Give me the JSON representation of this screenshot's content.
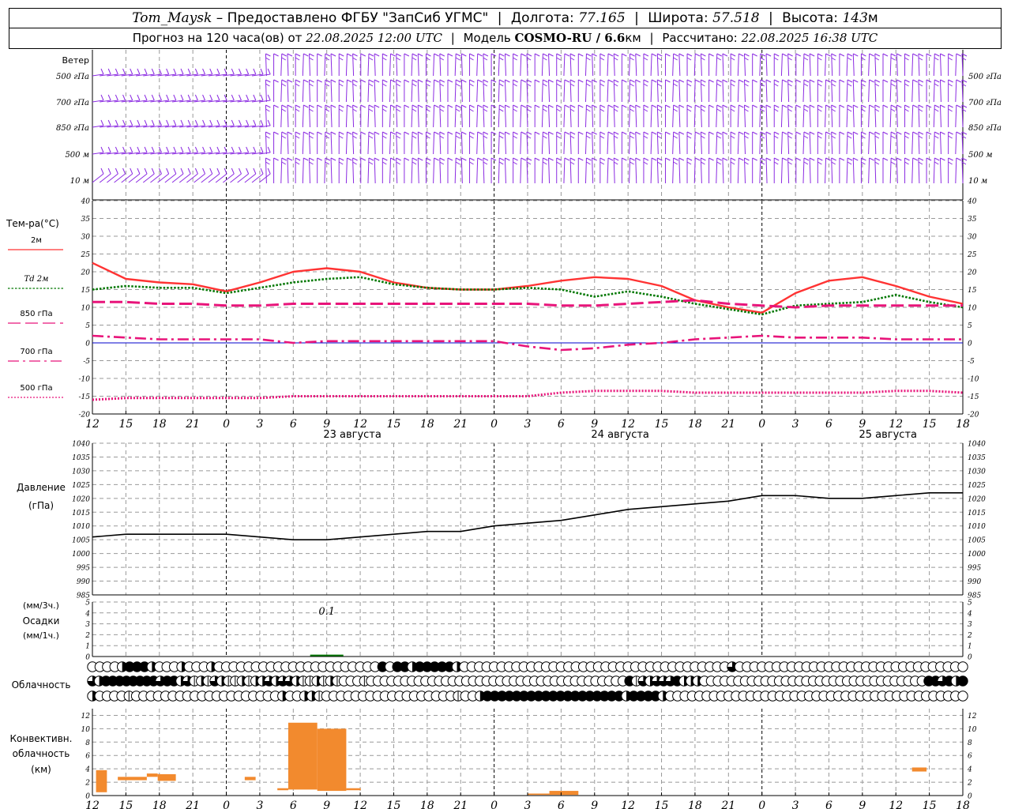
{
  "header": {
    "station": "Tom_Maysk",
    "provider": "– Предоставлено ФГБУ \"ЗапСиб УГМС\"",
    "lon_label": "Долгота:",
    "lon_value": "77.165",
    "lat_label": "Широта:",
    "lat_value": "57.518",
    "alt_label": "Высота:",
    "alt_value": "143",
    "alt_unit": "м",
    "forecast_prefix": "Прогноз на 120 часа(ов) от",
    "forecast_date": "22.08.2025 12:00 UTC",
    "model_label": "Модель",
    "model_name": "COSMO-RU / 6.6",
    "model_unit": "км",
    "calc_label": "Рассчитано:",
    "calc_date": "22.08.2025 16:38 UTC"
  },
  "labels": {
    "wind_title": "Ветер",
    "wind_levels": [
      "500 гПа",
      "700 гПа",
      "850 гПа",
      "500 м",
      "10 м"
    ],
    "temp_title": "Тем-ра(°C)",
    "temp_legend": [
      "2м",
      "Td 2м",
      "850 гПа",
      "700 гПа",
      "500 гПа"
    ],
    "pres_title_1": "Давление",
    "pres_title_2": "(гПа)",
    "precip_title_1": "(мм/3ч.)",
    "precip_title_2": "Осадки",
    "precip_title_3": "(мм/1ч.)",
    "precip_annotation": "0.1",
    "cloud_title": "Облачность",
    "conv_title_1": "Конвективн.",
    "conv_title_2": "облачность",
    "conv_title_3": "(км)"
  },
  "colors": {
    "t2m": "#ff3333",
    "td2m": "#007700",
    "t850": "#e8147a",
    "t700": "#e8147a",
    "t500": "#e8147a",
    "wind": "#8b2be2",
    "grid": "#999999",
    "conv": "#f28a2e",
    "pressure": "#000000",
    "zero_line": "#0000cc"
  },
  "chart_data": {
    "type": "line",
    "x_hour_ticks": [
      "12",
      "15",
      "18",
      "21",
      "0",
      "3",
      "6",
      "9",
      "12",
      "15",
      "18",
      "21",
      "0",
      "3",
      "6",
      "9",
      "12",
      "15",
      "18",
      "21",
      "0",
      "3",
      "6",
      "9",
      "12",
      "15",
      "18"
    ],
    "date_labels": [
      {
        "hour_index": 8,
        "text": "23 августа"
      },
      {
        "hour_index": 16,
        "text": "24 августа"
      },
      {
        "hour_index": 24,
        "text": "25 августа"
      }
    ],
    "forecast_hours": [
      0,
      3,
      6,
      9,
      12,
      15,
      18,
      21,
      24,
      27,
      30,
      33,
      36,
      39,
      42,
      45,
      48,
      51,
      54,
      57,
      60,
      63,
      66,
      69,
      72,
      75,
      78
    ],
    "temperature": {
      "ylim": [
        -20,
        40
      ],
      "yticks": [
        -20,
        -15,
        -10,
        -5,
        0,
        5,
        10,
        15,
        20,
        25,
        30,
        35,
        40
      ],
      "series": [
        {
          "name": "2м",
          "style": "solid",
          "values": [
            22.5,
            18,
            17,
            16.5,
            14.5,
            17,
            20,
            21,
            20,
            17,
            15.5,
            15,
            15,
            16,
            17.5,
            18.5,
            18,
            16,
            12,
            10,
            8.5,
            14,
            17.5,
            18.5,
            16,
            13,
            11
          ]
        },
        {
          "name": "Td 2м",
          "style": "dotted",
          "values": [
            15,
            16,
            15.5,
            15.5,
            14,
            15.5,
            17,
            18,
            18.5,
            16.5,
            15.5,
            15,
            15,
            15.5,
            15,
            13,
            14.5,
            13,
            11,
            9.5,
            8,
            10.5,
            11,
            11.5,
            13.5,
            11.5,
            10
          ]
        },
        {
          "name": "850 гПа",
          "style": "dashed",
          "values": [
            11.5,
            11.5,
            11,
            11,
            10.5,
            10.5,
            11,
            11,
            11,
            11,
            11,
            11,
            11,
            11,
            10.5,
            10.5,
            11,
            11.5,
            12,
            11,
            10.5,
            10,
            10.5,
            10.5,
            10.5,
            10.5,
            10.5
          ]
        },
        {
          "name": "700 гПа",
          "style": "dashdot",
          "values": [
            2,
            1.5,
            1,
            1,
            1,
            1,
            0,
            0.5,
            0.5,
            0.5,
            0.5,
            0.5,
            0.5,
            -1,
            -2,
            -1.5,
            -0.5,
            0,
            1,
            1.5,
            2,
            1.5,
            1.5,
            1.5,
            1,
            1,
            1
          ]
        },
        {
          "name": "500 гПа",
          "style": "dotted-fine",
          "values": [
            -16,
            -15.5,
            -15.5,
            -15.5,
            -15.5,
            -15.5,
            -15,
            -15,
            -15,
            -15,
            -15,
            -15,
            -15,
            -15,
            -14,
            -13.5,
            -13.5,
            -13.5,
            -14,
            -14,
            -14,
            -14,
            -14,
            -14,
            -13.5,
            -13.5,
            -14
          ]
        }
      ]
    },
    "pressure": {
      "ylim": [
        985,
        1040
      ],
      "yticks": [
        985,
        990,
        995,
        1000,
        1005,
        1010,
        1015,
        1020,
        1025,
        1030,
        1035,
        1040
      ],
      "values": [
        1006,
        1007,
        1007,
        1007,
        1007,
        1006,
        1005,
        1005,
        1006,
        1007,
        1008,
        1008,
        1010,
        1011,
        1012,
        1014,
        1016,
        1017,
        1018,
        1019,
        1021,
        1021,
        1020,
        1020,
        1021,
        1022,
        1022
      ]
    },
    "precipitation": {
      "ylim": [
        0,
        5
      ],
      "yticks": [
        0,
        1,
        2,
        3,
        4,
        5
      ],
      "max_label": "0.1",
      "values": [
        0,
        0,
        0,
        0,
        0,
        0,
        0,
        0.1,
        0,
        0,
        0,
        0,
        0,
        0,
        0,
        0,
        0,
        0,
        0,
        0,
        0,
        0,
        0,
        0,
        0,
        0,
        0
      ]
    },
    "cloud_cover_tenths": {
      "rows": [
        [
          0,
          0,
          0,
          0,
          2,
          4,
          4,
          4,
          2,
          0,
          0,
          0,
          2,
          0,
          0,
          0,
          2,
          0,
          0,
          0,
          0,
          0,
          0,
          0,
          0,
          0,
          0,
          0,
          0,
          0,
          0,
          0,
          0,
          0,
          0,
          0,
          0,
          0,
          0,
          4,
          0,
          4,
          4,
          2,
          4,
          4,
          4,
          4,
          4,
          2,
          0,
          0,
          0,
          0,
          0,
          0,
          0,
          0,
          0,
          0,
          0,
          0,
          0,
          0,
          0,
          0,
          0,
          0,
          0,
          0,
          0,
          0,
          0,
          0,
          0,
          0,
          0,
          0,
          0,
          0,
          0,
          0,
          0,
          0,
          0,
          0,
          3,
          0,
          0,
          0,
          0,
          0,
          0,
          0,
          0,
          0,
          0,
          0,
          0,
          0,
          0,
          0,
          0,
          0,
          0,
          0,
          0,
          0,
          0,
          0,
          0,
          0,
          0,
          0,
          0,
          0,
          0,
          0
        ],
        [
          3,
          2,
          4,
          4,
          4,
          4,
          4,
          4,
          4,
          4,
          3,
          4,
          4,
          2,
          3,
          1,
          2,
          1,
          3,
          2,
          1,
          1,
          2,
          1,
          2,
          2,
          3,
          2,
          3,
          3,
          2,
          1,
          1,
          2,
          1,
          2,
          1,
          0,
          0,
          0,
          1,
          0,
          0,
          0,
          0,
          0,
          0,
          0,
          0,
          0,
          0,
          0,
          0,
          0,
          0,
          0,
          0,
          0,
          0,
          0,
          0,
          0,
          0,
          0,
          0,
          0,
          0,
          0,
          0,
          0,
          0,
          0,
          0,
          0,
          0,
          0,
          0,
          0,
          0,
          4,
          1,
          3,
          2,
          3,
          3,
          3,
          4,
          2,
          2,
          2,
          0,
          0,
          0,
          0,
          0,
          0,
          0,
          0,
          0,
          0,
          0,
          0,
          0,
          0,
          0,
          0,
          0,
          0,
          0,
          0,
          0,
          0,
          0,
          0,
          0,
          0,
          0,
          0,
          0,
          0,
          0,
          0,
          0,
          4,
          4,
          3,
          4,
          2,
          4
        ],
        [
          2,
          0,
          0,
          0,
          0,
          1,
          0,
          0,
          0,
          0,
          0,
          0,
          0,
          0,
          0,
          0,
          0,
          0,
          0,
          0,
          0,
          0,
          0,
          0,
          0,
          0,
          2,
          0,
          0,
          2,
          2,
          1,
          0,
          0,
          0,
          0,
          0,
          0,
          0,
          0,
          0,
          0,
          0,
          0,
          0,
          0,
          0,
          0,
          0,
          0,
          1,
          0,
          0,
          2,
          4,
          4,
          4,
          4,
          4,
          4,
          4,
          4,
          4,
          4,
          4,
          4,
          4,
          4,
          4,
          4,
          4,
          4,
          4,
          2,
          4,
          4,
          4,
          4,
          2,
          0,
          0,
          0,
          0,
          0,
          0,
          0,
          0,
          0,
          0,
          0,
          0,
          0,
          0,
          0,
          0,
          0,
          0,
          0,
          0,
          0,
          0,
          0,
          0,
          0,
          0,
          0,
          0,
          0,
          0,
          0,
          0,
          0,
          0,
          0,
          0,
          0,
          0,
          0,
          0,
          0
        ]
      ]
    },
    "convective_cloud_km": {
      "ylim": [
        0,
        13
      ],
      "yticks": [
        0,
        2,
        4,
        6,
        8,
        10,
        12
      ],
      "bars": [
        {
          "from_h": 0.5,
          "to_h": 2,
          "base": 0.5,
          "top": 3.8
        },
        {
          "from_h": 3.5,
          "to_h": 7.5,
          "base": 2.3,
          "top": 2.8
        },
        {
          "from_h": 7.5,
          "to_h": 9,
          "base": 2.8,
          "top": 3.3
        },
        {
          "from_h": 9,
          "to_h": 11.5,
          "base": 2.2,
          "top": 3.2
        },
        {
          "from_h": 21,
          "to_h": 22.5,
          "base": 2.3,
          "top": 2.8
        },
        {
          "from_h": 25.5,
          "to_h": 27,
          "base": 0.8,
          "top": 1.1
        },
        {
          "from_h": 27,
          "to_h": 31,
          "base": 0.9,
          "top": 10.9
        },
        {
          "from_h": 31,
          "to_h": 35,
          "base": 0.7,
          "top": 10
        },
        {
          "from_h": 35,
          "to_h": 37,
          "base": 0.8,
          "top": 1.1
        },
        {
          "from_h": 60,
          "to_h": 63,
          "base": 0.1,
          "top": 0.3
        },
        {
          "from_h": 63,
          "to_h": 67,
          "base": 0.1,
          "top": 0.7
        },
        {
          "from_h": 113,
          "to_h": 115,
          "base": 3.6,
          "top": 4.2
        }
      ]
    }
  }
}
